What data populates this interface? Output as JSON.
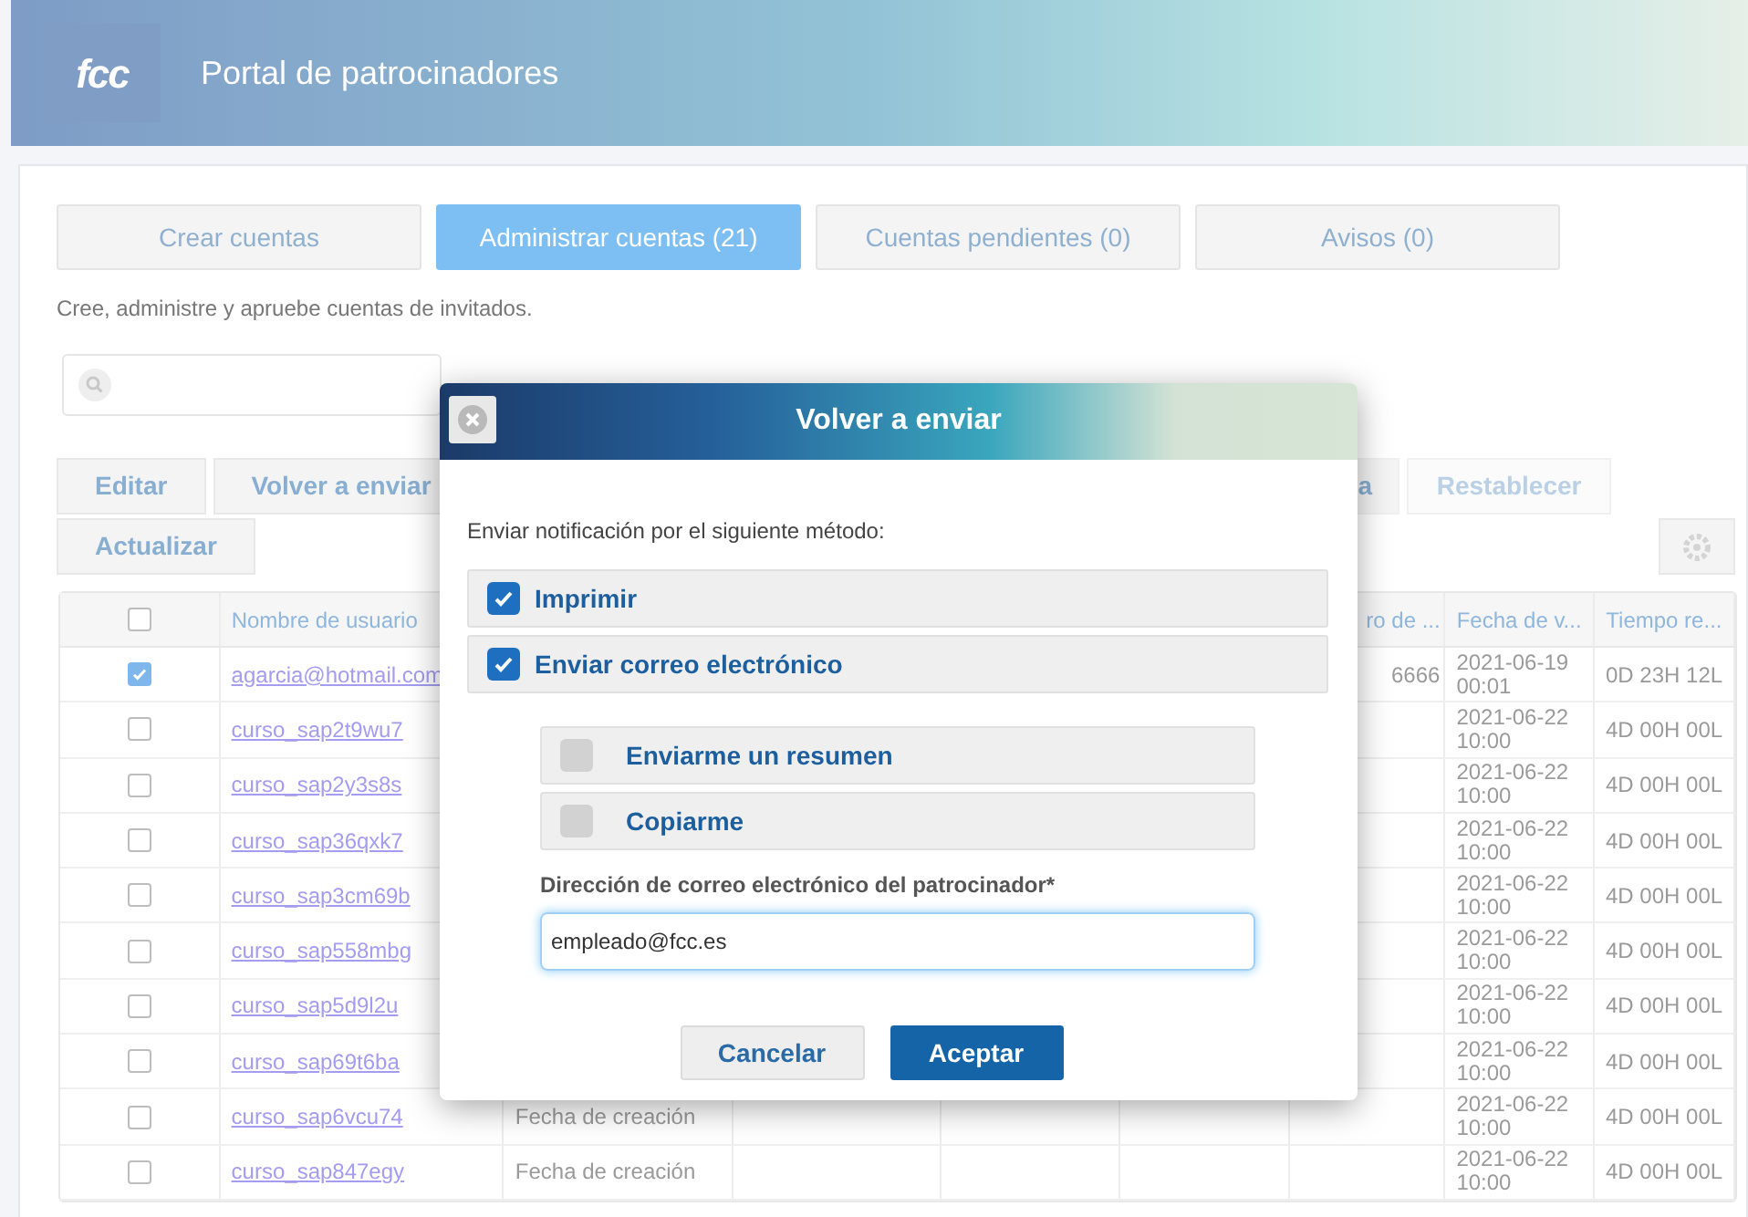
{
  "header": {
    "logo": "fcc",
    "title": "Portal de patrocinadores"
  },
  "tabs": [
    {
      "label": "Crear cuentas",
      "selected": false
    },
    {
      "label": "Administrar cuentas (21)",
      "selected": true
    },
    {
      "label": "Cuentas pendientes (0)",
      "selected": false
    },
    {
      "label": "Avisos (0)",
      "selected": false
    }
  ],
  "description": "Cree, administre y apruebe cuentas de invitados.",
  "toolbar": {
    "left": [
      {
        "label": "Editar",
        "disabled": false
      },
      {
        "label": "Volver a enviar",
        "disabled": false
      }
    ],
    "right": [
      {
        "label": "a",
        "disabled": false
      },
      {
        "label": "Restablecer",
        "disabled": true
      }
    ],
    "refresh": "Actualizar"
  },
  "table": {
    "select_all_checked": false,
    "columns": {
      "user": "Nombre de usuario",
      "column_7": "ro de ...",
      "expiry": "Fecha de v...",
      "remaining": "Tiempo re..."
    },
    "rows": [
      {
        "checked": true,
        "user": "agarcia@hotmail.com",
        "column_7": "6666",
        "expiry": "2021-06-19 00:01",
        "remaining": "0D 23H 12L"
      },
      {
        "checked": false,
        "user": "curso_sap2t9wu7",
        "expiry": "2021-06-22 10:00",
        "remaining": "4D 00H 00L"
      },
      {
        "checked": false,
        "user": "curso_sap2y3s8s",
        "expiry": "2021-06-22 10:00",
        "remaining": "4D 00H 00L"
      },
      {
        "checked": false,
        "user": "curso_sap36qxk7",
        "expiry": "2021-06-22 10:00",
        "remaining": "4D 00H 00L"
      },
      {
        "checked": false,
        "user": "curso_sap3cm69b",
        "expiry": "2021-06-22 10:00",
        "remaining": "4D 00H 00L"
      },
      {
        "checked": false,
        "user": "curso_sap558mbg",
        "expiry": "2021-06-22 10:00",
        "remaining": "4D 00H 00L"
      },
      {
        "checked": false,
        "user": "curso_sap5d9l2u",
        "expiry": "2021-06-22 10:00",
        "remaining": "4D 00H 00L"
      },
      {
        "checked": false,
        "user": "curso_sap69t6ba",
        "expiry": "2021-06-22 10:00",
        "remaining": "4D 00H 00L"
      },
      {
        "checked": false,
        "user": "curso_sap6vcu74",
        "column_3": "Fecha de creación",
        "expiry": "2021-06-22 10:00",
        "remaining": "4D 00H 00L"
      },
      {
        "checked": false,
        "user": "curso_sap847egy",
        "column_3": "Fecha de creación",
        "expiry": "2021-06-22 10:00",
        "remaining": "4D 00H 00L"
      }
    ]
  },
  "dialog": {
    "title": "Volver a enviar",
    "prompt": "Enviar notificación por el siguiente método:",
    "methods": [
      {
        "label": "Imprimir",
        "checked": true
      },
      {
        "label": "Enviar correo electrónico",
        "checked": true
      }
    ],
    "sub_options": [
      {
        "label": "Enviarme un resumen",
        "checked": false
      },
      {
        "label": "Copiarme",
        "checked": false
      }
    ],
    "email_label": "Dirección de correo electrónico del patrocinador*",
    "email_value": "empleado@fcc.es",
    "buttons": [
      {
        "kind": "secondary",
        "label": "Cancelar"
      },
      {
        "kind": "primary",
        "label": "Aceptar"
      }
    ]
  }
}
